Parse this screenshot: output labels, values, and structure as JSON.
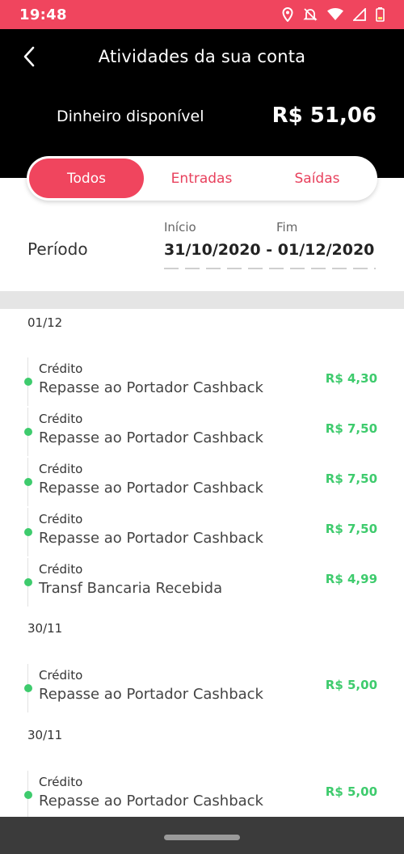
{
  "status_bar": {
    "time": "19:48",
    "icons": [
      "location-icon",
      "notifications-off-icon",
      "wifi-icon",
      "signal-icon",
      "battery-low-icon"
    ]
  },
  "header": {
    "back_icon": "chevron-left-icon",
    "title": "Atividades da sua conta",
    "balance_label": "Dinheiro disponível",
    "balance_value": "R$ 51,06"
  },
  "tabs": [
    {
      "label": "Todos",
      "active": true
    },
    {
      "label": "Entradas",
      "active": false
    },
    {
      "label": "Saídas",
      "active": false
    }
  ],
  "period": {
    "label": "Período",
    "start_label": "Início",
    "end_label": "Fim",
    "range": "31/10/2020 - 01/12/2020"
  },
  "groups": [
    {
      "date": "01/12",
      "items": [
        {
          "type": "Crédito",
          "description": "Repasse ao Portador Cashback",
          "amount": "R$ 4,30"
        },
        {
          "type": "Crédito",
          "description": "Repasse ao Portador Cashback",
          "amount": "R$ 7,50"
        },
        {
          "type": "Crédito",
          "description": "Repasse ao Portador Cashback",
          "amount": "R$ 7,50"
        },
        {
          "type": "Crédito",
          "description": "Repasse ao Portador Cashback",
          "amount": "R$ 7,50"
        },
        {
          "type": "Crédito",
          "description": "Transf Bancaria Recebida",
          "amount": "R$ 4,99"
        }
      ]
    },
    {
      "date": "30/11",
      "items": [
        {
          "type": "Crédito",
          "description": "Repasse ao Portador Cashback",
          "amount": "R$ 5,00"
        }
      ]
    },
    {
      "date": "30/11",
      "items": [
        {
          "type": "Crédito",
          "description": "Repasse ao Portador Cashback",
          "amount": "R$ 5,00"
        }
      ]
    }
  ],
  "colors": {
    "accent": "#f0455e",
    "credit_green": "#3ecb6d",
    "header_bg": "#000000"
  }
}
